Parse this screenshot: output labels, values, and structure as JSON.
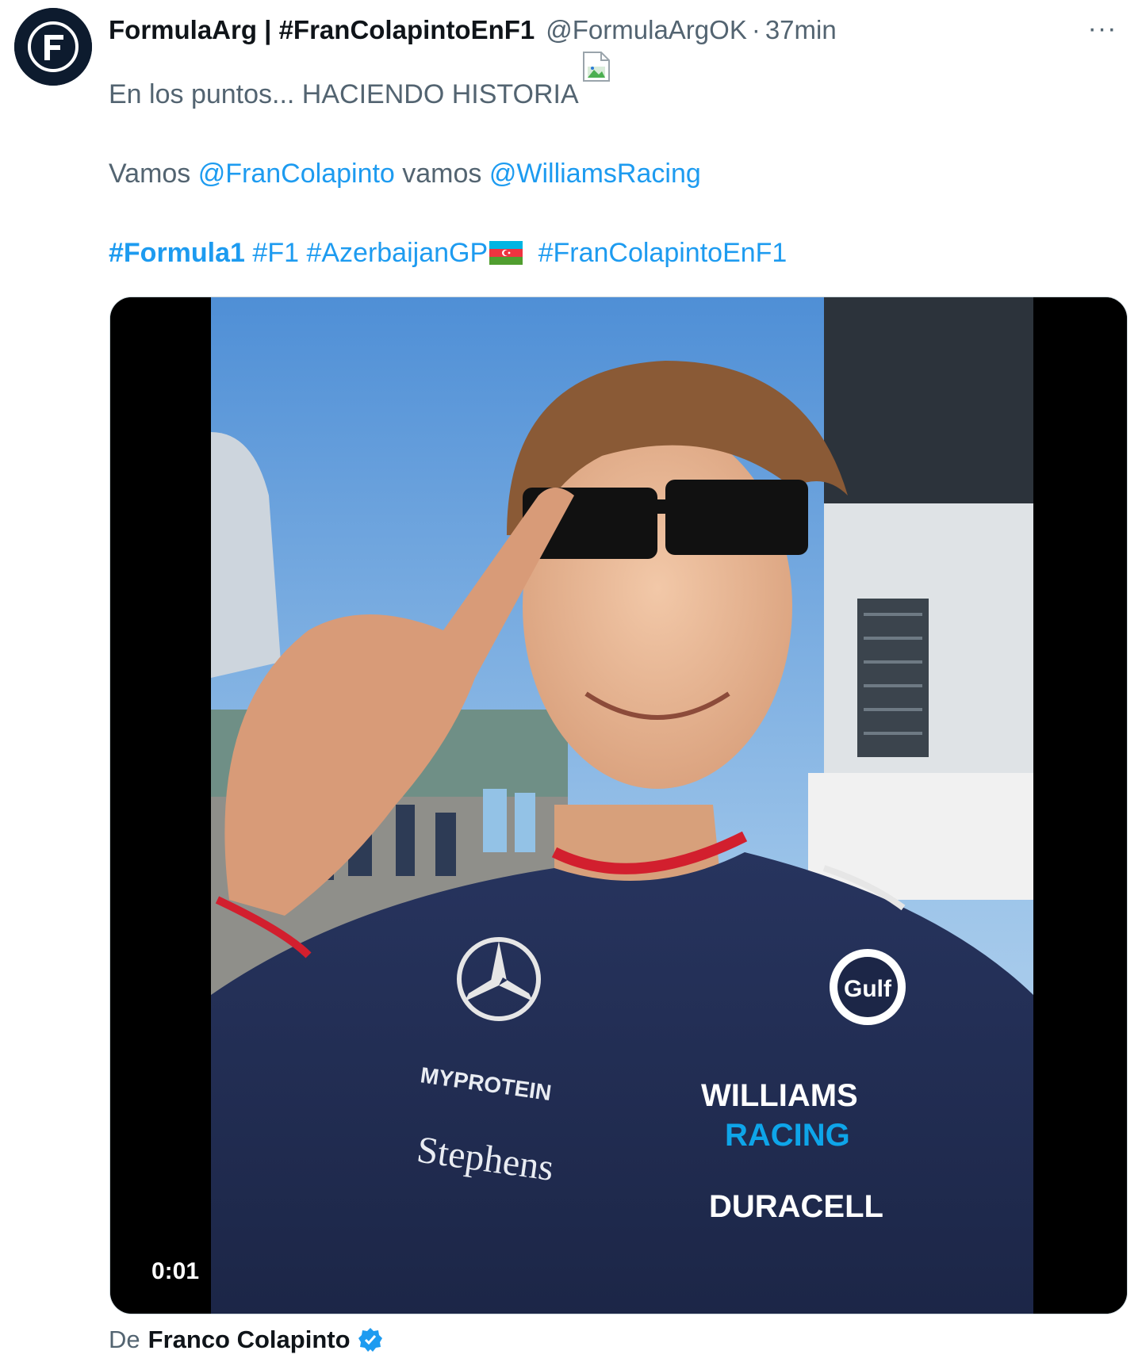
{
  "tweet": {
    "author_name": "FormulaArg | #FranColapintoEnF1",
    "handle": "@FormulaArgOK",
    "separator": "·",
    "time": "37min",
    "more_label": "···",
    "line1": "En los puntos... HACIENDO HISTORIA",
    "line2_prefix": "Vamos ",
    "mention1": "@FranColapinto",
    "line2_middle": " vamos ",
    "mention2": "@WilliamsRacing",
    "hashtags": [
      "#Formula1",
      "#F1",
      "#AzerbaijanGP",
      "#FranColapintoEnF1"
    ],
    "video_time": "0:01",
    "attribution_prefix": "De",
    "attribution_name": "Franco Colapinto"
  },
  "jersey": {
    "brand1": "MYPROTEIN",
    "brand2": "Stephens",
    "brand3": "WILLIAMS",
    "brand4": "RACING",
    "brand5": "DURACELL",
    "brand6": "Gulf"
  },
  "colors": {
    "link": "#1d9bf0",
    "secondary_text": "#536471",
    "primary_text": "#0f1419",
    "verified": "#1d9bf0"
  },
  "icons": {
    "avatar": "formulaarg-logo-icon",
    "more": "more-options-icon",
    "broken_image": "broken-image-icon",
    "flag": "azerbaijan-flag-icon",
    "verified": "verified-badge-icon"
  }
}
